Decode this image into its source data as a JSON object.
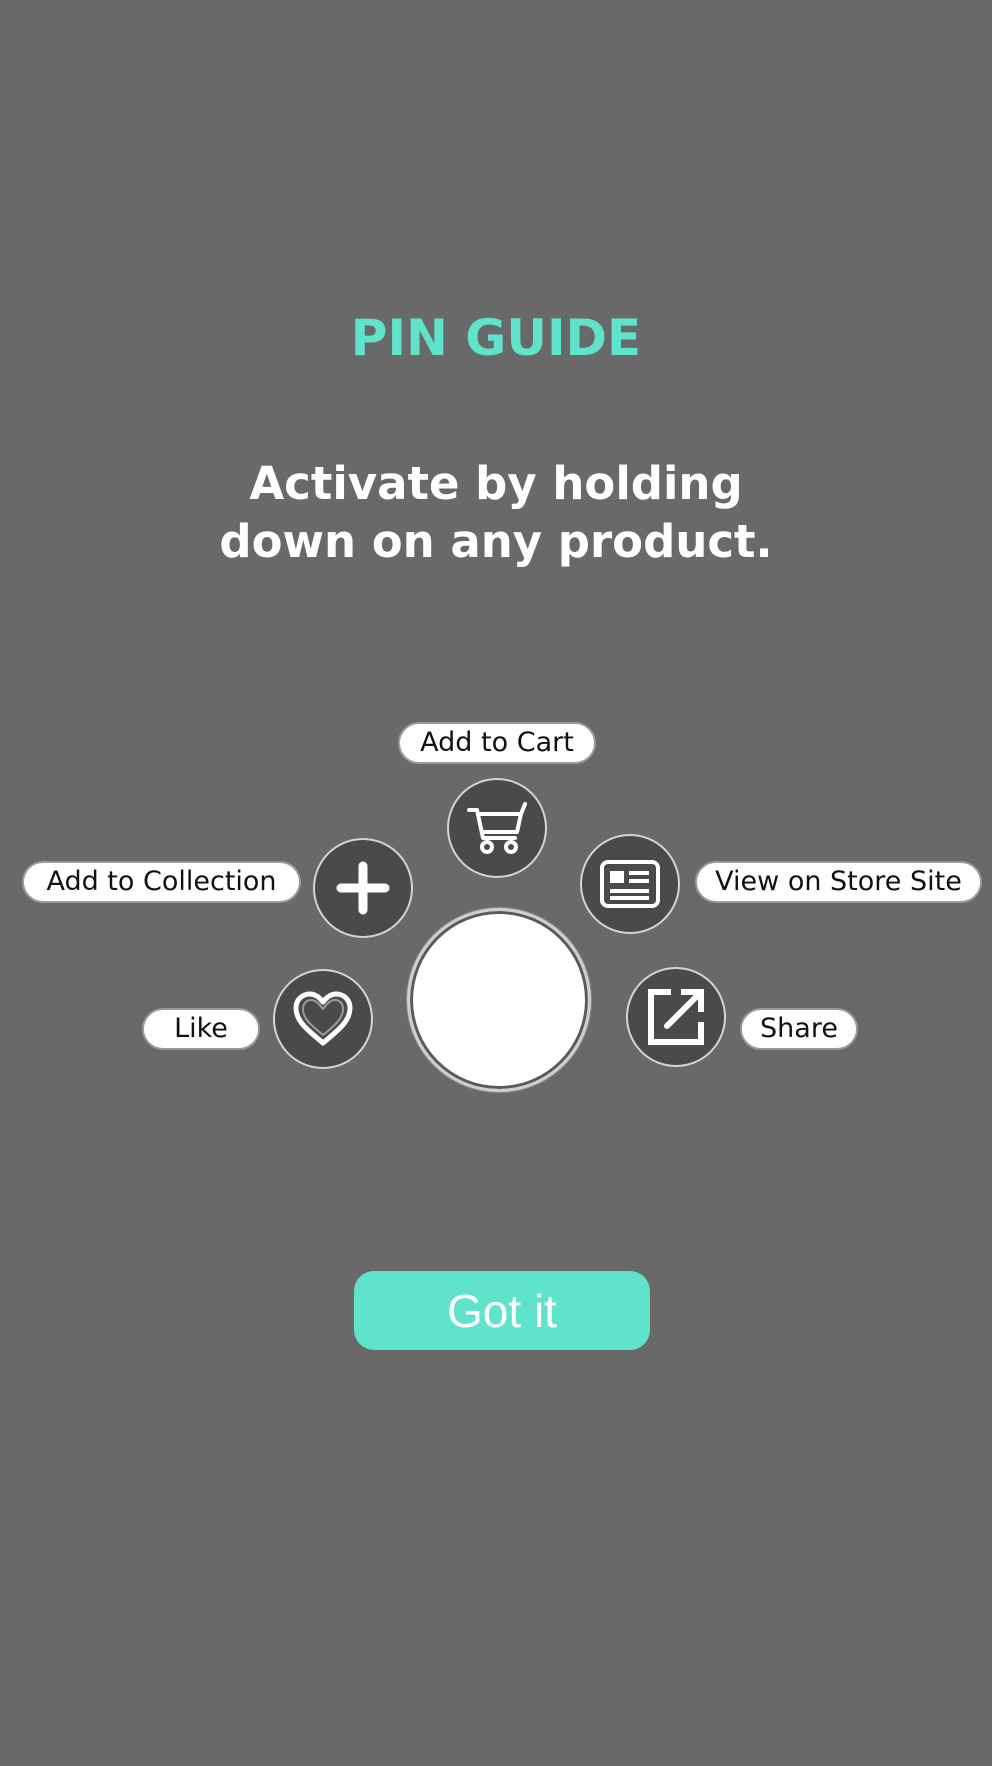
{
  "guide": {
    "title": "PIN GUIDE",
    "subtitle_line1": "Activate by holding",
    "subtitle_line2": "down on any product."
  },
  "actions": {
    "add_to_cart": {
      "label": "Add to Cart",
      "icon": "cart-icon"
    },
    "add_to_collection": {
      "label": "Add to Collection",
      "icon": "plus-icon"
    },
    "view_on_store_site": {
      "label": "View on Store Site",
      "icon": "article-icon"
    },
    "like": {
      "label": "Like",
      "icon": "heart-icon"
    },
    "share": {
      "label": "Share",
      "icon": "share-icon"
    }
  },
  "confirm": {
    "label": "Got it"
  },
  "colors": {
    "background": "#696969",
    "accent": "#5fe3cb",
    "icon_bg": "#4a4a4a"
  }
}
